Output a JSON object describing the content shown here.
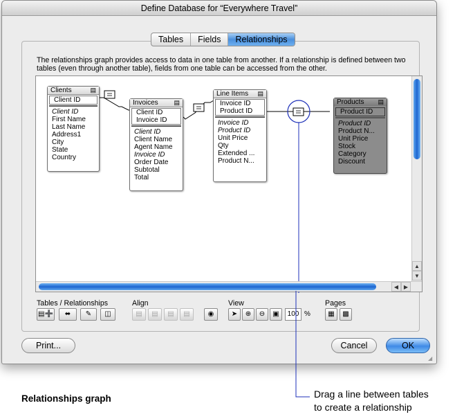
{
  "window": {
    "title": "Define Database for “Everywhere Travel”"
  },
  "tabs": [
    {
      "label": "Tables",
      "active": false
    },
    {
      "label": "Fields",
      "active": false
    },
    {
      "label": "Relationships",
      "active": true
    }
  ],
  "description": "The relationships graph provides access to data in one table from another. If a relationship is defined between two tables (even through another table), fields from one table can be accessed from the other.",
  "tables": [
    {
      "name": "Clients",
      "keys": [
        "Client ID"
      ],
      "fields": [
        {
          "name": "Client ID",
          "italic": true
        },
        {
          "name": "First Name"
        },
        {
          "name": "Last Name"
        },
        {
          "name": "Address1"
        },
        {
          "name": "City"
        },
        {
          "name": "State"
        },
        {
          "name": "Country"
        }
      ]
    },
    {
      "name": "Invoices",
      "keys": [
        "Client ID",
        "Invoice ID"
      ],
      "fields": [
        {
          "name": "Client ID",
          "italic": true
        },
        {
          "name": "Client Name"
        },
        {
          "name": "Agent Name"
        },
        {
          "name": "Invoice ID",
          "italic": true
        },
        {
          "name": "Order Date"
        },
        {
          "name": "Subtotal"
        },
        {
          "name": "Total"
        }
      ]
    },
    {
      "name": "Line Items",
      "keys": [
        "Invoice ID",
        "Product ID"
      ],
      "fields": [
        {
          "name": "Invoice ID",
          "italic": true
        },
        {
          "name": "Product ID",
          "italic": true
        },
        {
          "name": "Unit Price"
        },
        {
          "name": "Qty"
        },
        {
          "name": "Extended ..."
        },
        {
          "name": "Product N..."
        }
      ]
    },
    {
      "name": "Products",
      "selected": true,
      "keys": [
        "Product ID"
      ],
      "fields": [
        {
          "name": "Product ID",
          "italic": true
        },
        {
          "name": "Product N..."
        },
        {
          "name": "Unit Price"
        },
        {
          "name": "Stock"
        },
        {
          "name": "Category"
        },
        {
          "name": "Discount"
        }
      ]
    }
  ],
  "toolbar": {
    "groups": [
      "Tables / Relationships",
      "Align",
      "View",
      "Pages"
    ],
    "zoom_value": "100",
    "zoom_unit": "%",
    "icons": [
      "add-table-icon",
      "add-relationship-icon",
      "edit-pencil-icon",
      "delete-icon",
      "align-left-icon",
      "align-center-icon",
      "align-top-icon",
      "align-middle-icon",
      "color-wheel-icon",
      "pointer-tool-icon",
      "zoom-in-icon",
      "zoom-out-icon",
      "fit-icon",
      "page-breaks-icon",
      "page-setup-icon"
    ]
  },
  "buttons": {
    "print": "Print...",
    "cancel": "Cancel",
    "ok": "OK"
  },
  "callout": {
    "line1": "Drag a line between tables",
    "line2": "to create a relationship"
  },
  "caption": "Relationships graph",
  "colors": {
    "accent": "#3f8ae6",
    "callout_line": "#1c2fb8"
  }
}
